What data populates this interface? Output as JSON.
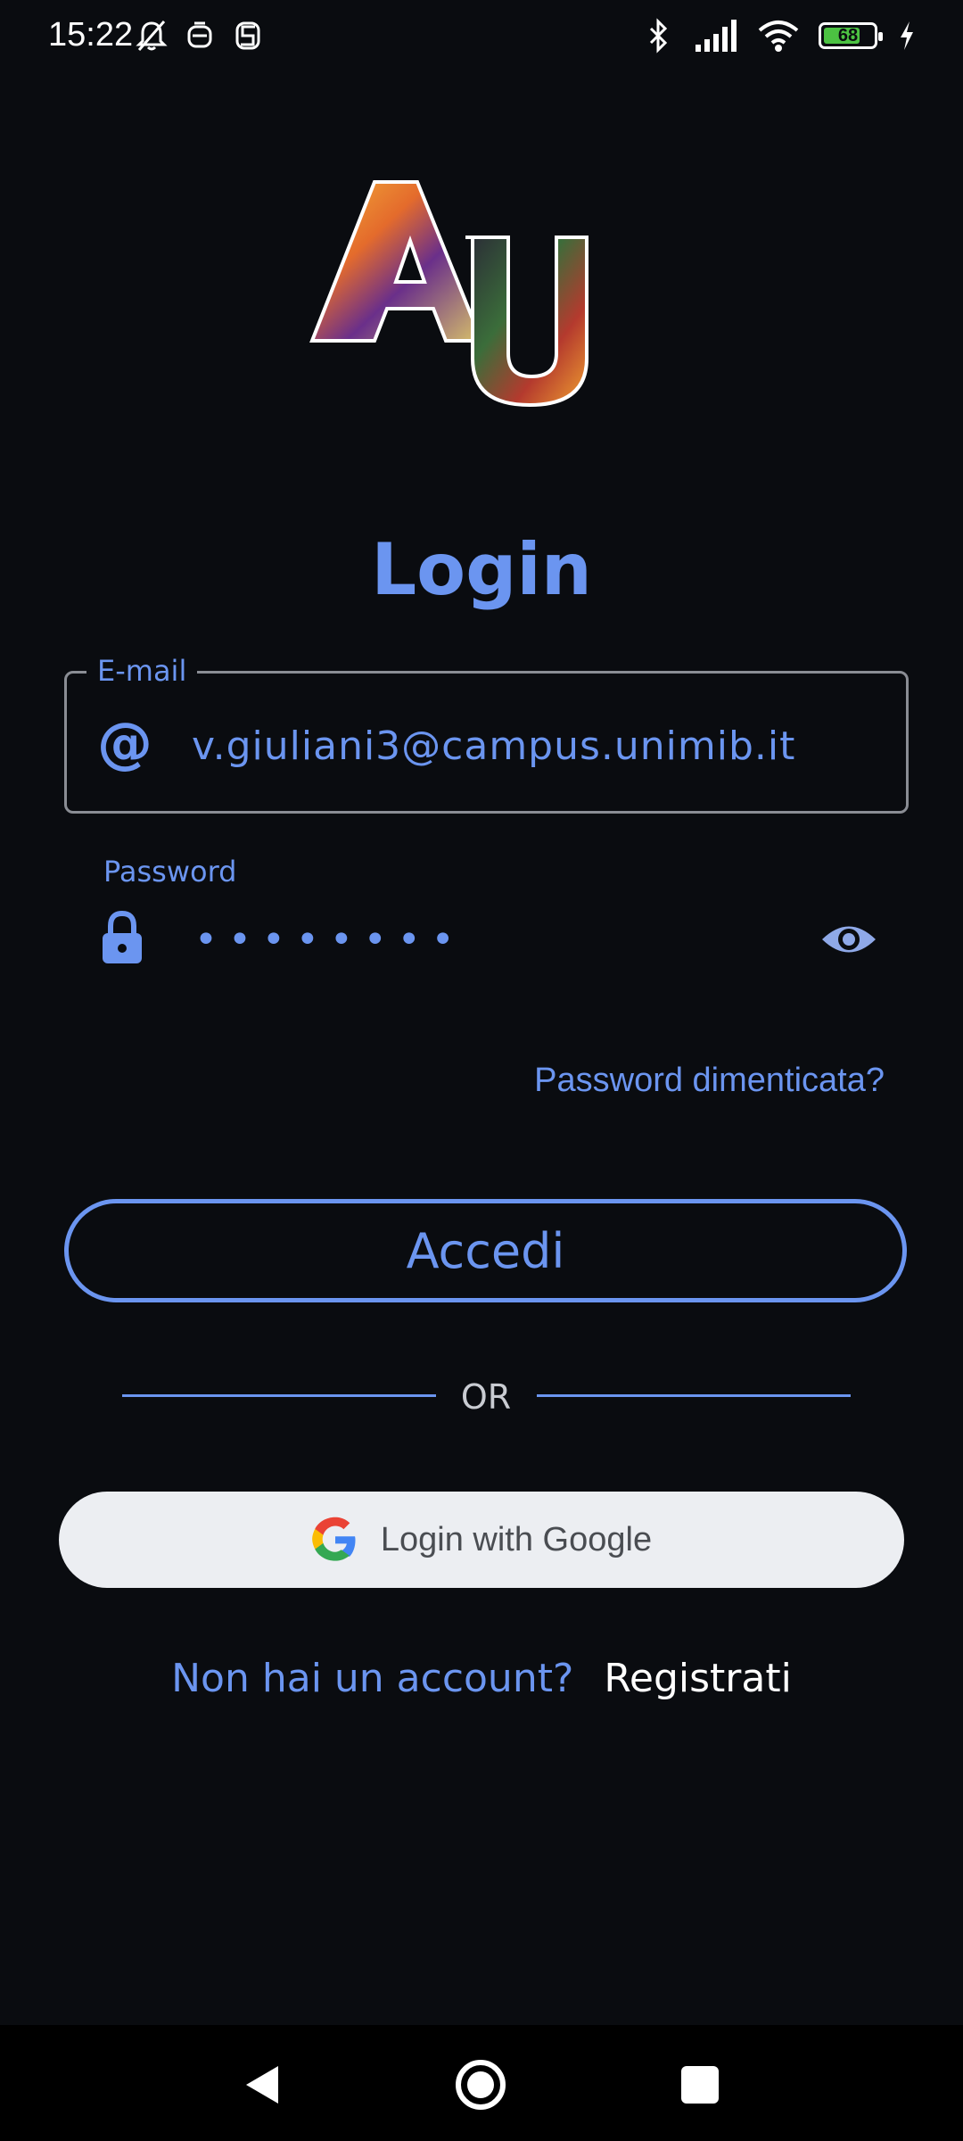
{
  "status_bar": {
    "time": "15:22",
    "battery_level": "68",
    "icons": [
      "bell-off-icon",
      "notification-icon",
      "notification-icon",
      "bluetooth-icon",
      "signal-icon",
      "wifi-icon",
      "battery-icon",
      "charging-icon"
    ]
  },
  "title": "Login",
  "email": {
    "label": "E-mail",
    "value": "v.giuliani3@campus.unimib.it",
    "icon": "at-icon"
  },
  "password": {
    "label": "Password",
    "value": "••••••••",
    "icon": "lock-icon",
    "toggle_icon": "eye-icon"
  },
  "forgot_password": "Password dimenticata?",
  "login_button": "Accedi",
  "divider_text": "OR",
  "google_button": "Login with Google",
  "register": {
    "prompt": "Non hai un account?",
    "link": "Registrati"
  },
  "colors": {
    "background": "#0a0c10",
    "accent": "#6b95f0",
    "google_button_bg": "#eceef2"
  }
}
